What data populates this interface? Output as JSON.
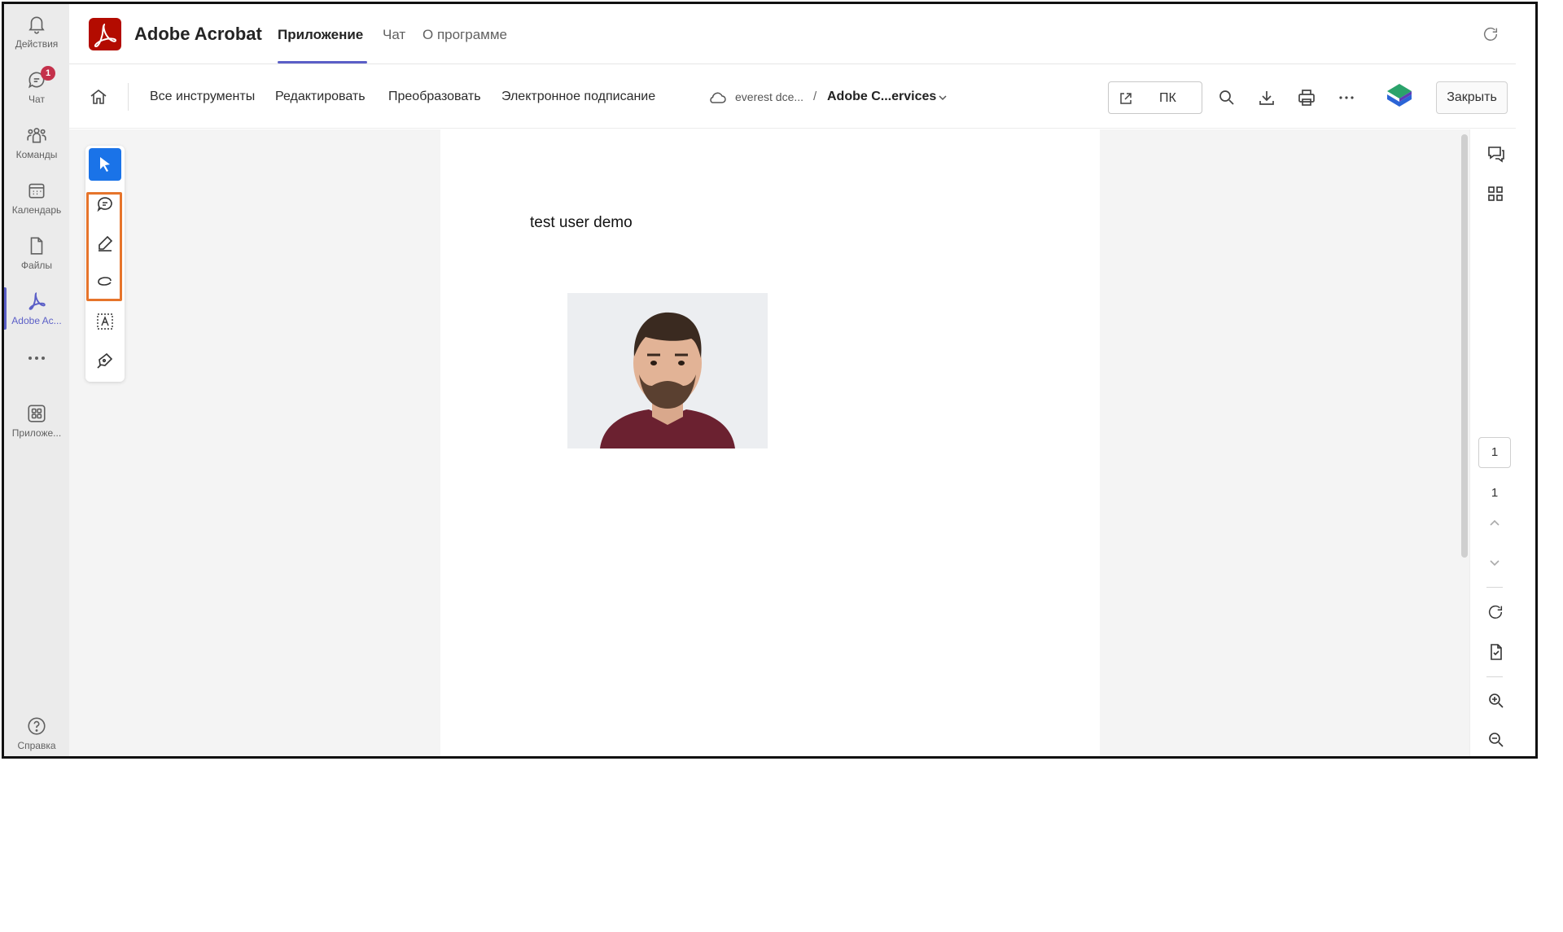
{
  "rail": {
    "items": [
      {
        "label": "Действия",
        "icon": "bell-icon"
      },
      {
        "label": "Чат",
        "icon": "chat-icon",
        "badge": "1"
      },
      {
        "label": "Команды",
        "icon": "teams-icon"
      },
      {
        "label": "Календарь",
        "icon": "calendar-icon"
      },
      {
        "label": "Файлы",
        "icon": "file-icon"
      },
      {
        "label": "Adobe Ac...",
        "icon": "acrobat-icon",
        "active": true
      },
      {
        "label": "",
        "icon": "more-icon"
      },
      {
        "label": "Приложе...",
        "icon": "apps-icon"
      }
    ],
    "help_label": "Справка"
  },
  "appbar": {
    "title": "Adobe Acrobat",
    "tabs": [
      {
        "label": "Приложение",
        "active": true
      },
      {
        "label": "Чат"
      },
      {
        "label": "О программе"
      }
    ],
    "accent_color": "#5b5fc7"
  },
  "toolbar": {
    "menu": [
      "Все инструменты",
      "Редактировать",
      "Преобразовать",
      "Электронное подписание"
    ],
    "breadcrumb": {
      "folder": "everest dce...",
      "separator": "/",
      "file": "Adobe C...ervices"
    },
    "open_in_label": "ПК",
    "close_label": "Закрыть"
  },
  "document": {
    "text": "test user demo"
  },
  "pagination": {
    "current": "1",
    "total": "1"
  },
  "colors": {
    "acrobat_red": "#b30b00",
    "tool_active": "#1a73e8",
    "highlight_box": "#e6742b",
    "badge": "#c4314b"
  }
}
